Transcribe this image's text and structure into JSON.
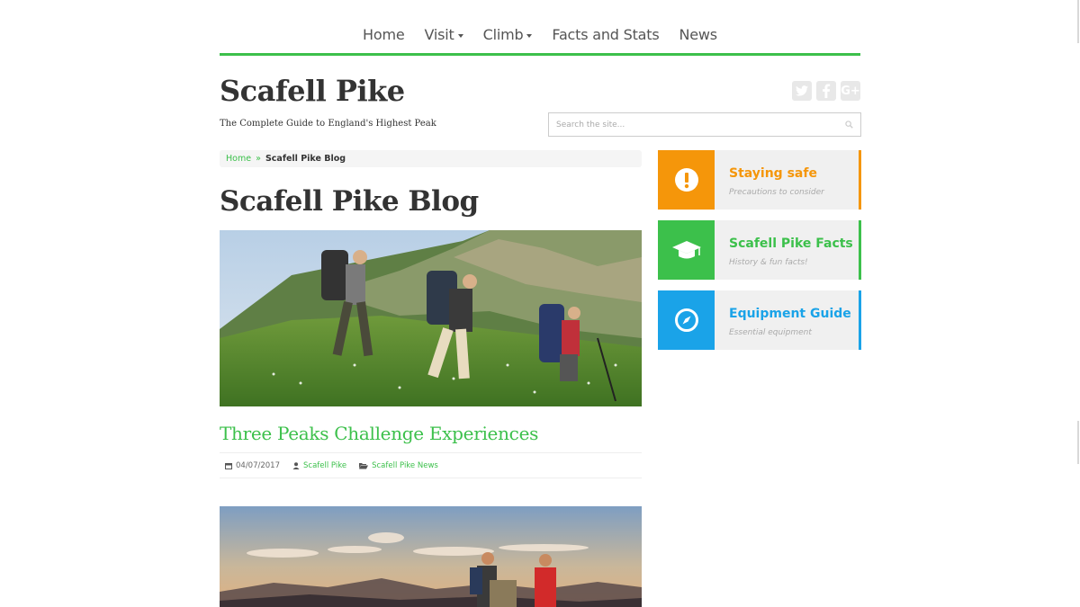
{
  "nav": {
    "items": [
      {
        "label": "Home"
      },
      {
        "label": "Visit",
        "has_dropdown": true
      },
      {
        "label": "Climb",
        "has_dropdown": true
      },
      {
        "label": "Facts and Stats"
      },
      {
        "label": "News"
      }
    ]
  },
  "header": {
    "site_title": "Scafell Pike",
    "tagline": "The Complete Guide to England's Highest Peak",
    "social": [
      {
        "icon": "twitter-icon"
      },
      {
        "icon": "facebook-icon"
      },
      {
        "icon": "google-plus-icon",
        "glyph": "G+"
      }
    ]
  },
  "search": {
    "placeholder": "Search the site..."
  },
  "breadcrumb": {
    "home": "Home",
    "separator": "»",
    "current": "Scafell Pike Blog"
  },
  "page": {
    "title": "Scafell Pike Blog"
  },
  "posts": [
    {
      "title": "Three Peaks Challenge Experiences",
      "date": "04/07/2017",
      "author": "Scafell Pike",
      "category": "Scafell Pike News"
    }
  ],
  "sidebar": {
    "boxes": [
      {
        "title": "Staying safe",
        "subtitle": "Precautions to consider",
        "icon": "exclamation-icon",
        "color": "#f5960a"
      },
      {
        "title": "Scafell Pike Facts",
        "subtitle": "History & fun facts!",
        "icon": "graduation-cap-icon",
        "color": "#3cc04b"
      },
      {
        "title": "Equipment Guide",
        "subtitle": "Essential equipment",
        "icon": "compass-icon",
        "color": "#1aa3e8"
      }
    ]
  },
  "theme": {
    "accent": "#3cc04b"
  }
}
